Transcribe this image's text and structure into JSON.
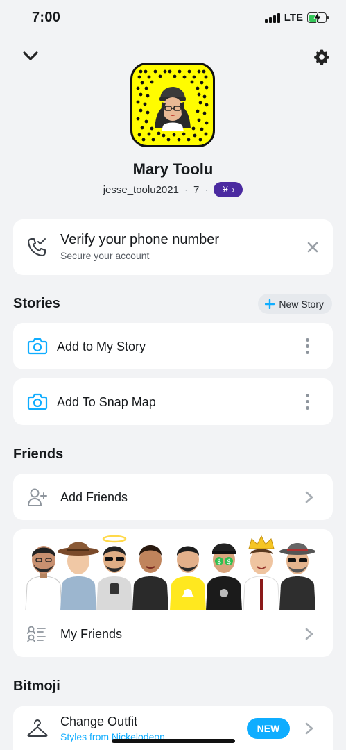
{
  "status_bar": {
    "time": "7:00",
    "network": "LTE"
  },
  "profile": {
    "name": "Mary Toolu",
    "username": "jesse_toolu2021",
    "score": "7",
    "zodiac_symbol": "♓",
    "zodiac_chevron": "›"
  },
  "verify_card": {
    "title": "Verify your phone number",
    "subtitle": "Secure your account"
  },
  "stories": {
    "title": "Stories",
    "new_story_label": "New Story",
    "items": [
      {
        "label": "Add to My Story",
        "icon": "camera-icon"
      },
      {
        "label": "Add To Snap Map",
        "icon": "camera-icon"
      }
    ]
  },
  "friends": {
    "title": "Friends",
    "add_friends_label": "Add Friends",
    "my_friends_label": "My Friends"
  },
  "bitmoji": {
    "title": "Bitmoji",
    "change_outfit_label": "Change Outfit",
    "change_outfit_sub": "Styles from Nickelodeon",
    "badge": "NEW"
  },
  "colors": {
    "snap_yellow": "#fffc00",
    "accent_blue": "#0fadff",
    "zodiac_purple": "#4b2aa0"
  }
}
